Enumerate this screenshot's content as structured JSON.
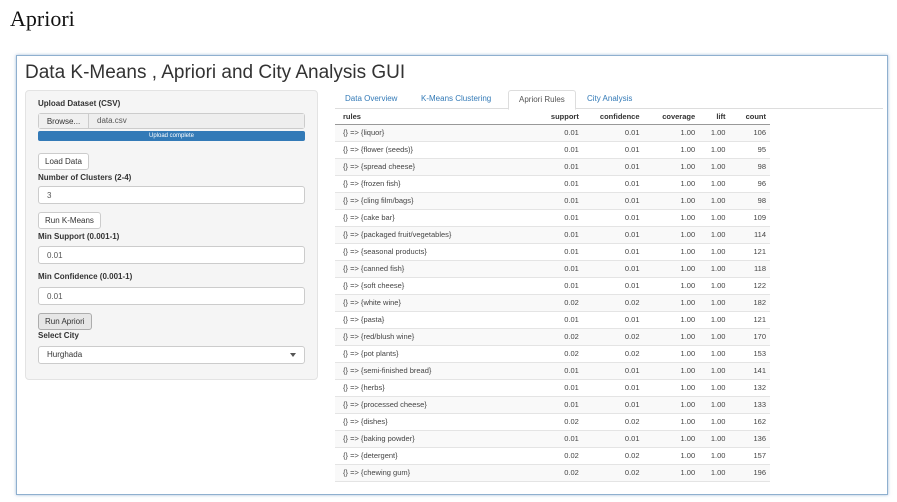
{
  "doc_caption": "Apriori",
  "app": {
    "title": "Data K-Means , Apriori and City Analysis GUI"
  },
  "sidebar": {
    "upload_label": "Upload Dataset (CSV)",
    "browse_label": "Browse...",
    "file_name": "data.csv",
    "progress_text": "Upload complete",
    "progress_percent": 100,
    "load_button": "Load Data",
    "clusters_label": "Number of Clusters (2-4)",
    "clusters_value": "3",
    "kmeans_button": "Run K-Means",
    "support_label": "Min Support (0.001-1)",
    "support_value": "0.01",
    "confidence_label": "Min Confidence (0.001-1)",
    "confidence_value": "0.01",
    "apriori_button": "Run Apriori",
    "city_label": "Select City",
    "city_value": "Hurghada"
  },
  "tabs": [
    {
      "label": "Data Overview"
    },
    {
      "label": "K-Means Clustering"
    },
    {
      "label": "Apriori Rules"
    },
    {
      "label": "City Analysis"
    }
  ],
  "table": {
    "columns": [
      "rules",
      "support",
      "confidence",
      "coverage",
      "lift",
      "count"
    ],
    "rows": [
      [
        "{} => {liquor}",
        "0.01",
        "0.01",
        "1.00",
        "1.00",
        "106"
      ],
      [
        "{} => {flower (seeds)}",
        "0.01",
        "0.01",
        "1.00",
        "1.00",
        "95"
      ],
      [
        "{} => {spread cheese}",
        "0.01",
        "0.01",
        "1.00",
        "1.00",
        "98"
      ],
      [
        "{} => {frozen fish}",
        "0.01",
        "0.01",
        "1.00",
        "1.00",
        "96"
      ],
      [
        "{} => {cling film/bags}",
        "0.01",
        "0.01",
        "1.00",
        "1.00",
        "98"
      ],
      [
        "{} => {cake bar}",
        "0.01",
        "0.01",
        "1.00",
        "1.00",
        "109"
      ],
      [
        "{} => {packaged fruit/vegetables}",
        "0.01",
        "0.01",
        "1.00",
        "1.00",
        "114"
      ],
      [
        "{} => {seasonal products}",
        "0.01",
        "0.01",
        "1.00",
        "1.00",
        "121"
      ],
      [
        "{} => {canned fish}",
        "0.01",
        "0.01",
        "1.00",
        "1.00",
        "118"
      ],
      [
        "{} => {soft cheese}",
        "0.01",
        "0.01",
        "1.00",
        "1.00",
        "122"
      ],
      [
        "{} => {white wine}",
        "0.02",
        "0.02",
        "1.00",
        "1.00",
        "182"
      ],
      [
        "{} => {pasta}",
        "0.01",
        "0.01",
        "1.00",
        "1.00",
        "121"
      ],
      [
        "{} => {red/blush wine}",
        "0.02",
        "0.02",
        "1.00",
        "1.00",
        "170"
      ],
      [
        "{} => {pot plants}",
        "0.02",
        "0.02",
        "1.00",
        "1.00",
        "153"
      ],
      [
        "{} => {semi-finished bread}",
        "0.01",
        "0.01",
        "1.00",
        "1.00",
        "141"
      ],
      [
        "{} => {herbs}",
        "0.01",
        "0.01",
        "1.00",
        "1.00",
        "132"
      ],
      [
        "{} => {processed cheese}",
        "0.01",
        "0.01",
        "1.00",
        "1.00",
        "133"
      ],
      [
        "{} => {dishes}",
        "0.02",
        "0.02",
        "1.00",
        "1.00",
        "162"
      ],
      [
        "{} => {baking powder}",
        "0.01",
        "0.01",
        "1.00",
        "1.00",
        "136"
      ],
      [
        "{} => {detergent}",
        "0.02",
        "0.02",
        "1.00",
        "1.00",
        "157"
      ],
      [
        "{} => {chewing gum}",
        "0.02",
        "0.02",
        "1.00",
        "1.00",
        "196"
      ]
    ]
  }
}
